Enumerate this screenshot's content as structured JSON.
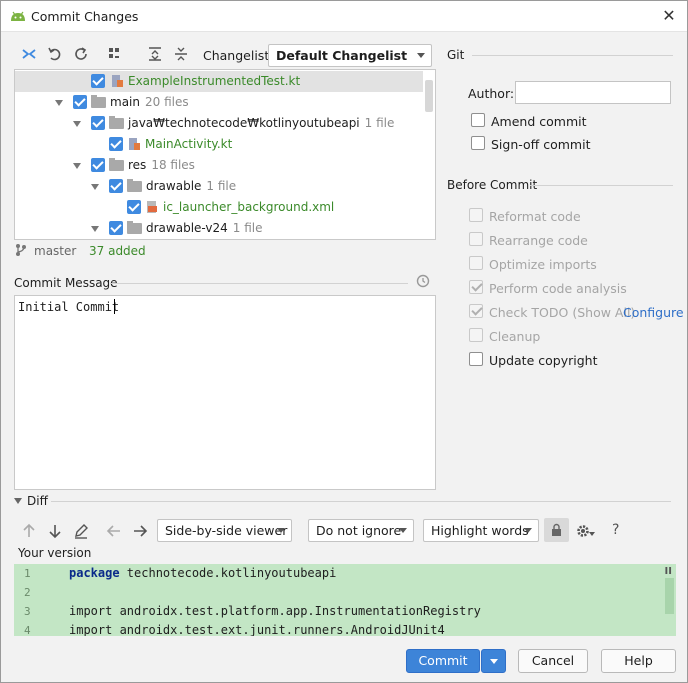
{
  "window": {
    "title": "Commit Changes",
    "close_glyph": "✕"
  },
  "toolbar": {
    "changelist_label": "Changelist:",
    "changelist_value": "Default Changelist"
  },
  "tree": {
    "rows": [
      {
        "label": "ExampleInstrumentedTest.kt",
        "count": "",
        "type": "kt-file",
        "green": true
      },
      {
        "label": "main",
        "count": "20 files",
        "type": "folder"
      },
      {
        "label": "java₩technotecode₩kotlinyoutubeapi",
        "count": "1 file",
        "type": "folder"
      },
      {
        "label": "MainActivity.kt",
        "count": "",
        "type": "kt-file",
        "green": true
      },
      {
        "label": "res",
        "count": "18 files",
        "type": "folder"
      },
      {
        "label": "drawable",
        "count": "1 file",
        "type": "folder"
      },
      {
        "label": "ic_launcher_background.xml",
        "count": "",
        "type": "xml-file",
        "green": true
      },
      {
        "label": "drawable-v24",
        "count": "1 file",
        "type": "folder"
      }
    ]
  },
  "status": {
    "branch": "master",
    "added": "37 added"
  },
  "commit_message": {
    "label": "Commit Message",
    "text": "Initial Commit"
  },
  "git": {
    "section": "Git",
    "author_label": "Author:",
    "author_value": "",
    "amend": "Amend commit",
    "signoff": "Sign-off commit"
  },
  "before_commit": {
    "section": "Before Commit",
    "options": [
      {
        "label": "Reformat code",
        "checked": false,
        "disabled": true
      },
      {
        "label": "Rearrange code",
        "checked": false,
        "disabled": true
      },
      {
        "label": "Optimize imports",
        "checked": false,
        "disabled": true
      },
      {
        "label": "Perform code analysis",
        "checked": true,
        "disabled": true
      },
      {
        "label": "Check TODO (Show All)",
        "checked": true,
        "disabled": true,
        "link": "Configure"
      },
      {
        "label": "Cleanup",
        "checked": false,
        "disabled": true
      },
      {
        "label": "Update copyright",
        "checked": false,
        "disabled": false
      }
    ]
  },
  "diff": {
    "label": "Diff",
    "viewer": "Side-by-side viewer",
    "ignore": "Do not ignore",
    "highlight": "Highlight words",
    "help": "?",
    "your_version": "Your version",
    "lines": [
      {
        "num": "1",
        "kw": "package",
        "text": " technotecode.kotlinyoutubeapi"
      },
      {
        "num": "2",
        "kw": "",
        "text": ""
      },
      {
        "num": "3",
        "kw": "",
        "text": "import androidx.test.platform.app.InstrumentationRegistry"
      },
      {
        "num": "4",
        "kw": "",
        "text": "import androidx.test.ext.junit.runners.AndroidJUnit4"
      }
    ]
  },
  "buttons": {
    "commit": "Commit",
    "cancel": "Cancel",
    "help": "Help"
  },
  "colors": {
    "accent": "#3d84d8",
    "added_green": "#3b8a2a",
    "diff_bg": "#c3e6c5"
  }
}
